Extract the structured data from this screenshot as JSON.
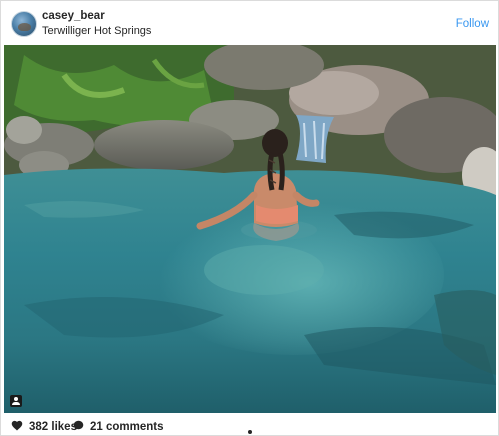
{
  "post": {
    "username": "casey_bear",
    "location": "Terwilliger Hot Springs",
    "follow_label": "Follow"
  },
  "footer": {
    "likes": "382 likes",
    "comments": "21 comments"
  },
  "icons": {
    "avatar": "profile-photo",
    "like": "heart-icon",
    "comment": "comment-bubble-icon",
    "tag": "user-tag-icon"
  },
  "colors": {
    "follow_link": "#3897f0",
    "text": "#262626",
    "border": "#dbdbdb"
  }
}
